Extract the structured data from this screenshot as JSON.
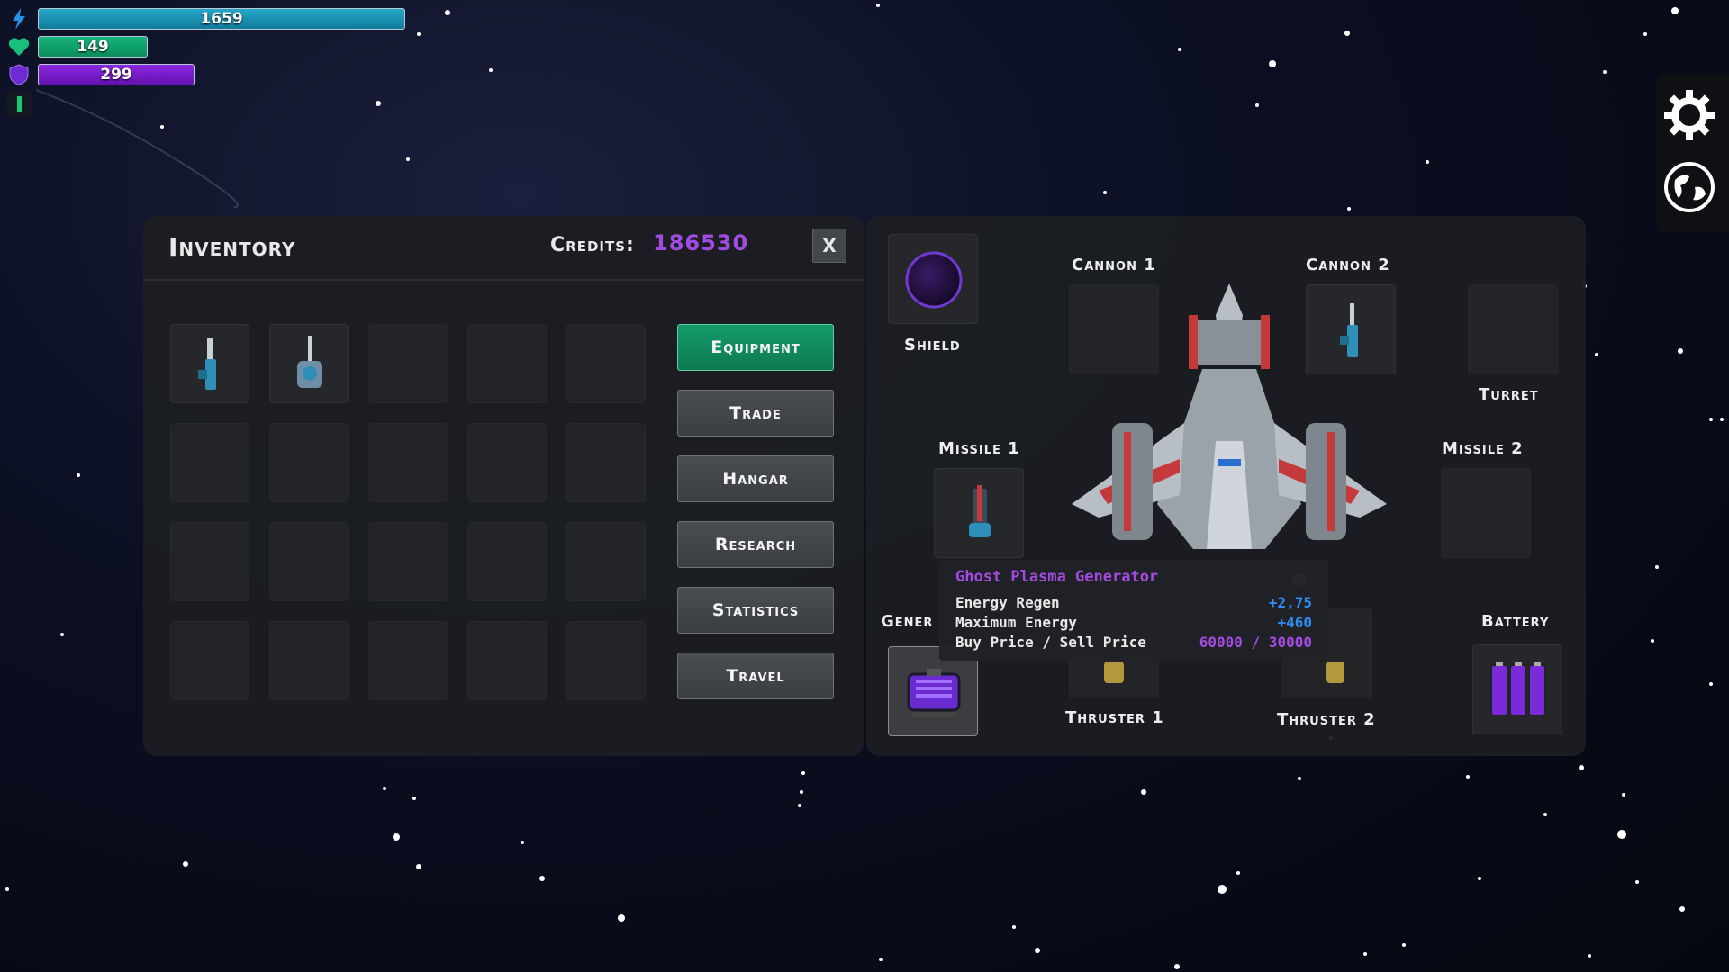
{
  "hud": {
    "energy": {
      "value": "1659",
      "icon": "lightning-icon",
      "color": "#1a9ab8"
    },
    "health": {
      "value": "149",
      "icon": "heart-icon",
      "color": "#11a86b"
    },
    "armor": {
      "value": "299",
      "icon": "shield-icon",
      "color": "#7a1fd0"
    }
  },
  "inventory": {
    "title": "Inventory",
    "credits_label": "Credits:",
    "credits_value": "186530",
    "close_label": "X",
    "items": [
      {
        "name": "cannon-item",
        "icon": "cannon-icon"
      },
      {
        "name": "turret-item",
        "icon": "turret-icon"
      }
    ]
  },
  "menu": {
    "items": [
      "Equipment",
      "Trade",
      "Hangar",
      "Research",
      "Statistics",
      "Travel"
    ],
    "active": "Equipment"
  },
  "equipment": {
    "shield": "Shield",
    "cannon1": "Cannon 1",
    "cannon2": "Cannon 2",
    "turret": "Turret",
    "missile1": "Missile 1",
    "missile2": "Missile 2",
    "generator": "Gener",
    "battery": "Battery",
    "thruster1": "Thruster 1",
    "thruster2": "Thruster 2"
  },
  "tooltip": {
    "title": "Ghost Plasma Generator",
    "rows": [
      {
        "label": "Energy Regen",
        "value": "+2,75"
      },
      {
        "label": "Maximum Energy",
        "value": "+460"
      },
      {
        "label": "Buy Price / Sell Price",
        "value": "60000 / 30000"
      }
    ],
    "title_color": "#a24be0",
    "stat_color": "#2f8bf0",
    "price_color": "#a24be0"
  },
  "side_buttons": [
    "gear-icon",
    "globe-icon"
  ]
}
